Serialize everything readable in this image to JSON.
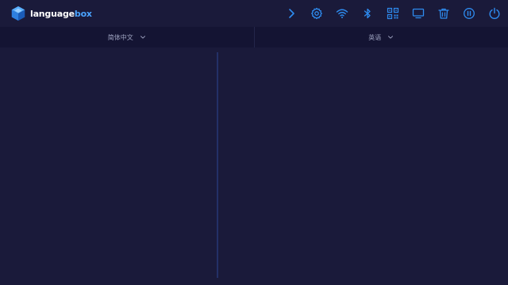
{
  "app": {
    "logo_text_main": "language",
    "logo_text_accent": "box"
  },
  "colors": {
    "background": "#1a1a3a",
    "langbar": "#141433",
    "accent": "#2e8cf0",
    "divider": "#233067"
  },
  "toolbar": {
    "icons": [
      "chevron-right-icon",
      "gear-icon",
      "wifi-icon",
      "bluetooth-icon",
      "qr-code-icon",
      "monitor-icon",
      "trash-icon",
      "pause-icon",
      "power-icon"
    ]
  },
  "languages": {
    "source": "简体中文",
    "target": "英语"
  }
}
